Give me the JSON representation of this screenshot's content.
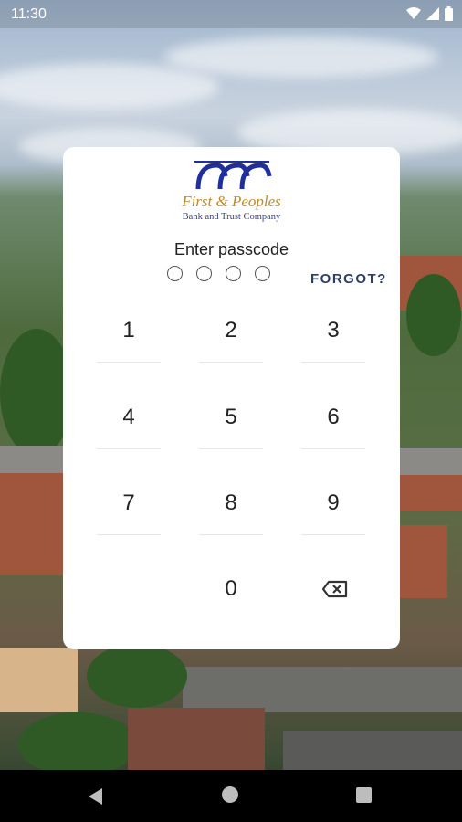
{
  "status": {
    "time": "11:30"
  },
  "logo": {
    "name": "First & Peoples",
    "tagline": "Bank and Trust Company"
  },
  "passcode": {
    "prompt": "Enter passcode",
    "forgot_label": "FORGOT?",
    "digits_entered": 0,
    "length": 4
  },
  "keypad": {
    "k1": "1",
    "k2": "2",
    "k3": "3",
    "k4": "4",
    "k5": "5",
    "k6": "6",
    "k7": "7",
    "k8": "8",
    "k9": "9",
    "k0": "0"
  },
  "colors": {
    "brand_gold": "#c08a2a",
    "brand_blue": "#1f2f9e",
    "forgot_text": "#2c3e66"
  }
}
